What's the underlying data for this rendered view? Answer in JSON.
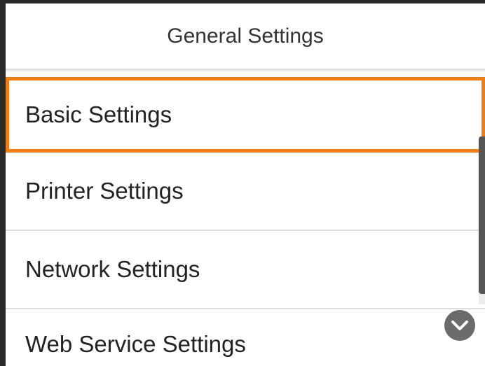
{
  "header": {
    "title": "General Settings"
  },
  "menu": {
    "items": [
      {
        "label": "Basic Settings",
        "selected": true
      },
      {
        "label": "Printer Settings",
        "selected": false
      },
      {
        "label": "Network Settings",
        "selected": false
      },
      {
        "label": "Web Service Settings",
        "selected": false
      }
    ]
  },
  "colors": {
    "selection_border": "#f07d1a",
    "scroll_thumb": "#555555",
    "chevron_button": "#6b6b6b"
  },
  "icons": {
    "scroll_down": "chevron-down-icon"
  }
}
